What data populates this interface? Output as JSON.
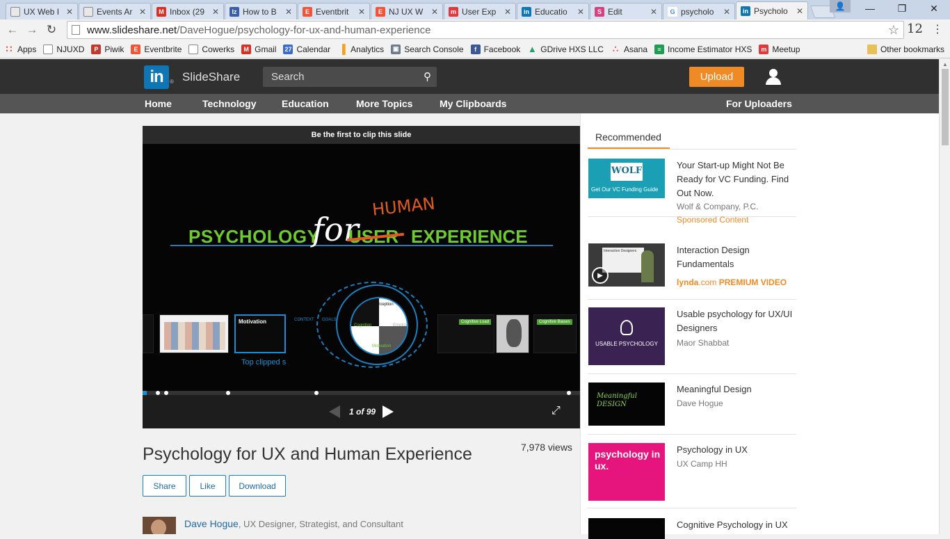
{
  "tabs": [
    {
      "title": "UX Web I",
      "icon": "page",
      "color": "#e8e8e8"
    },
    {
      "title": "Events Ar",
      "icon": "page",
      "color": "#e8e8e8"
    },
    {
      "title": "Inbox (29",
      "icon": "M",
      "color": "#d93025"
    },
    {
      "title": "How to B",
      "icon": "lz",
      "color": "#3a5fa8"
    },
    {
      "title": "Eventbrit",
      "icon": "E",
      "color": "#f05537"
    },
    {
      "title": "NJ UX W",
      "icon": "E",
      "color": "#f05537"
    },
    {
      "title": "User Exp",
      "icon": "meetup",
      "color": "#e0393e"
    },
    {
      "title": "Educatio",
      "icon": "in",
      "color": "#0e76b5"
    },
    {
      "title": "Edit",
      "icon": "S",
      "color": "#d9417e"
    },
    {
      "title": "psycholo",
      "icon": "G",
      "color": "#4285f4"
    },
    {
      "title": "Psycholo",
      "icon": "in",
      "color": "#0e76b5",
      "active": true
    }
  ],
  "browser": {
    "url_host": "www.slideshare.net",
    "url_path": "/DaveHogue/psychology-for-ux-and-human-experience",
    "ext_badge": "12"
  },
  "bookmarks": [
    {
      "label": "Apps",
      "color": "#d64b3a",
      "icon": "grid"
    },
    {
      "label": "NJUXD",
      "color": "#ffffff",
      "icon": "page"
    },
    {
      "label": "Piwik",
      "color": "#c0392b",
      "icon": "P"
    },
    {
      "label": "Eventbrite",
      "color": "#f05537",
      "icon": "E"
    },
    {
      "label": "Cowerks",
      "color": "#ffffff",
      "icon": "page"
    },
    {
      "label": "Gmail",
      "color": "#d93025",
      "icon": "M"
    },
    {
      "label": "Calendar",
      "color": "#3b6cc7",
      "icon": "27"
    },
    {
      "label": "Analytics",
      "color": "#f4a11d",
      "icon": "bars"
    },
    {
      "label": "Search Console",
      "color": "#6d7b8d",
      "icon": "sc"
    },
    {
      "label": "Facebook",
      "color": "#3b5998",
      "icon": "f"
    },
    {
      "label": "GDrive HXS LLC",
      "color": "#1fa463",
      "icon": "drive"
    },
    {
      "label": "Asana",
      "color": "#e8505b",
      "icon": "asana"
    },
    {
      "label": "Income Estimator HXS",
      "color": "#1f9d55",
      "icon": "sheet"
    },
    {
      "label": "Meetup",
      "color": "#e0393e",
      "icon": "meetup"
    }
  ],
  "other_bookmarks": "Other bookmarks",
  "header": {
    "logo_text": "in",
    "brand": "SlideShare",
    "search_placeholder": "Search",
    "upload_label": "Upload",
    "nav": [
      "Home",
      "Technology",
      "Education",
      "More Topics",
      "My Clipboards"
    ],
    "nav_right": "For Uploaders"
  },
  "player": {
    "clip_prompt": "Be the first to clip this slide",
    "slide_words": {
      "psychology": "PSYCHOLOGY",
      "for": "for",
      "user": "USER",
      "human": "HUMAN",
      "experience": "EXPERIENCE"
    },
    "thumb_labels": [
      "Motivation",
      "Cognitive Load",
      "Cognitive Biases"
    ],
    "diagram_labels": [
      "Perception",
      "Cognition",
      "Emotion",
      "Motivation",
      "CONTEXT",
      "GOALS"
    ],
    "top_clipped": "Top clipped s",
    "page_current": "1",
    "page_total": "99",
    "page_of": "of",
    "progress_fraction": 0.01
  },
  "doc": {
    "title": "Psychology for UX and Human Experience",
    "views": "7,978 views",
    "buttons": [
      "Share",
      "Like",
      "Download"
    ],
    "author_name": "Dave Hogue",
    "author_role": ", UX Designer, Strategist, and Consultant"
  },
  "sidebar": {
    "tab_label": "Recommended",
    "items": [
      {
        "title": "Your Start-up Might Not Be Ready for VC Funding. Find Out Now.",
        "sub": "Wolf & Company, P.C.",
        "extra": "Sponsored Content",
        "thumb_text": "WOLF",
        "thumb_caption": "Get Our VC Funding Guide"
      },
      {
        "title": "Interaction Design Fundamentals",
        "sub": "",
        "extra_a": "lynda",
        "extra_b": ".com",
        "extra_c": "PREMIUM VIDEO",
        "thumb_text": "Interaction Designers"
      },
      {
        "title": "Usable psychology for UX/UI Designers",
        "sub": "Maor Shabbat",
        "thumb_text": "USABLE PSYCHOLOGY"
      },
      {
        "title": "Meaningful Design",
        "sub": "Dave Hogue",
        "thumb_text": "Meaningful DESIGN"
      },
      {
        "title": "Psychology in UX",
        "sub": "UX Camp HH",
        "thumb_text": "psychology in ux."
      },
      {
        "title": "Cognitive Psychology in UX",
        "sub": ""
      }
    ]
  }
}
